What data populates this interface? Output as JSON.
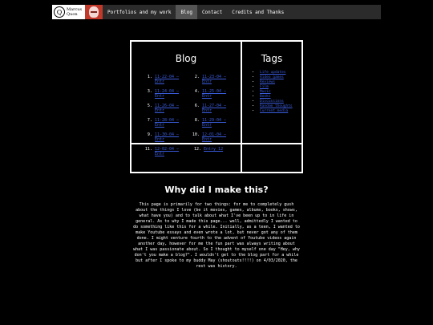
{
  "nav": {
    "logo_line1": "Marcus",
    "logo_line2": "Quon",
    "items": [
      {
        "label": "Portfolios and my work"
      },
      {
        "label": "Blog"
      },
      {
        "label": "Contact"
      },
      {
        "label": "Credits and Thanks"
      }
    ],
    "active_item": "Blog"
  },
  "blog": {
    "title": "Blog",
    "posts": [
      {
        "num": "1.",
        "label": "11-22-04 — Entr"
      },
      {
        "num": "2.",
        "label": "11-23-04 — Entr"
      },
      {
        "num": "3.",
        "label": "11-24-04 — Entr"
      },
      {
        "num": "4.",
        "label": "11-25-04 — Entr"
      },
      {
        "num": "5.",
        "label": "11-26-04 — Entr"
      },
      {
        "num": "6.",
        "label": "11-27-04 — Entr"
      },
      {
        "num": "7.",
        "label": "11-28-04 — Entr"
      },
      {
        "num": "8.",
        "label": "11-29-04 — Entr"
      },
      {
        "num": "9.",
        "label": "11-30-04 — Entr"
      },
      {
        "num": "10.",
        "label": "12-01-04 — Entr"
      },
      {
        "num": "11.",
        "label": "12-02-04 — Entr"
      },
      {
        "num": "12.",
        "label": "Entry 12"
      }
    ]
  },
  "tags": {
    "title": "Tags",
    "items": [
      {
        "label": "Life updates"
      },
      {
        "label": "Video games"
      },
      {
        "label": "Reviews"
      },
      {
        "label": "Film"
      },
      {
        "label": "Music"
      },
      {
        "label": "Books"
      },
      {
        "label": "Discussions"
      },
      {
        "label": "Random thoughts"
      },
      {
        "label": "Current media"
      }
    ]
  },
  "section": {
    "title": "Why did I make this?",
    "body": "This page is primarily for two things: for me to completely gush about the things I love (be it movies, games, albums, books, shows, what have you) and to talk about what I've been up to in life in general. As to why I made this page... well, admittedly I wanted to do something like this for a while. Initially, as a teen, I wanted to make Youtube essays and even wrote a lot, but never got any of them done. I might venture fourth to the advent of Youtube videos again another day, however for me the fun part was always writing about what I was passionate about. So I thought to myself one day \"Hey, why don't you make a blog?\". I wouldn't get to the blog part for a while but after I spoke to my buddy May (shoutouts!!!!) on 4/03/2020, the rest was history."
  },
  "colors": {
    "background": "#000000",
    "nav_background": "#2b2b2b",
    "nav_active": "#555555",
    "link": "#3a5bd9",
    "border": "#ffffff"
  }
}
